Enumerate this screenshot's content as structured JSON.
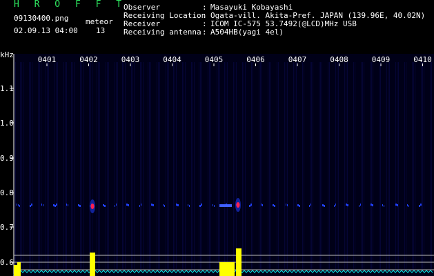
{
  "header": {
    "title": "H R O F F T",
    "file_name": "09130400.png",
    "datetime": "02.09.13 04:00",
    "meteor_label": "meteor",
    "meteor_count": "13"
  },
  "info": [
    {
      "key": "Observer",
      "sep": ":",
      "value": "Masayuki Kobayashi"
    },
    {
      "key": "Receiving Location",
      "sep": ":",
      "value": "Ogata-vill. Akita-Pref. JAPAN (139.96E, 40.02N)"
    },
    {
      "key": "Receiver",
      "sep": ":",
      "value": "ICOM IC-575 53.7492(@LCD)MHz USB"
    },
    {
      "key": "Receiving antenna",
      "sep": ":",
      "value": "A504HB(yagi 4el)"
    }
  ],
  "chart_data": {
    "type": "heatmap",
    "ylabel": "kHz",
    "y_ticks": [
      "1.1",
      "1.0",
      "0.9",
      "0.8",
      "0.7",
      "0.6"
    ],
    "x_ticks": [
      "0401",
      "0402",
      "0403",
      "0404",
      "0405",
      "0406",
      "0407",
      "0408",
      "0409",
      "0410"
    ],
    "colors": {
      "background": "#000018",
      "tick": "#ffffff",
      "signal": "#2040ff",
      "echo_core": "#ff2050",
      "level": "#ffff00",
      "noise": "#00e0e0"
    }
  }
}
